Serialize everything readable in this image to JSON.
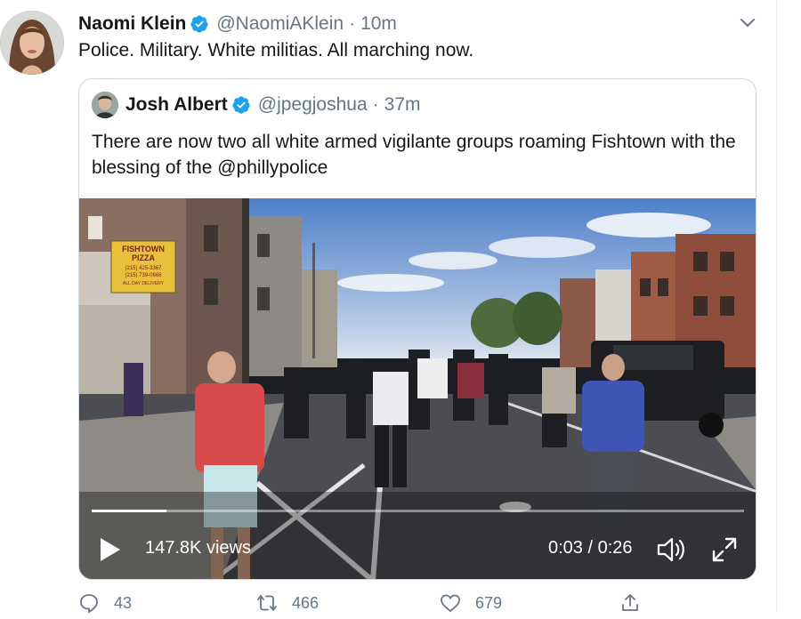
{
  "tweet": {
    "author_name": "Naomi Klein",
    "handle": "@NaomiAKlein",
    "separator": "·",
    "time": "10m",
    "text": "Police. Military. White militias. All marching now."
  },
  "quoted": {
    "author_name": "Josh Albert",
    "handle": "@jpegjoshua",
    "separator": "·",
    "time": "37m",
    "text": "There are now two all white armed vigilante groups roaming Fishtown with the blessing of the @phillypolice"
  },
  "video": {
    "views": "147.8K views",
    "current_time": "0:03",
    "time_separator": " / ",
    "duration": "0:26",
    "progress": 0.115,
    "sign_lines": [
      "FISHTOWN",
      "PIZZA",
      "(215) 425-3367",
      "(215) 739-0668",
      "ALL DAY DELIVERY"
    ]
  },
  "actions": {
    "replies": "43",
    "retweets": "466",
    "likes": "679"
  },
  "colors": {
    "verified": "#1da1f2",
    "secondary_text": "#657786",
    "border": "#ccd6dd"
  }
}
